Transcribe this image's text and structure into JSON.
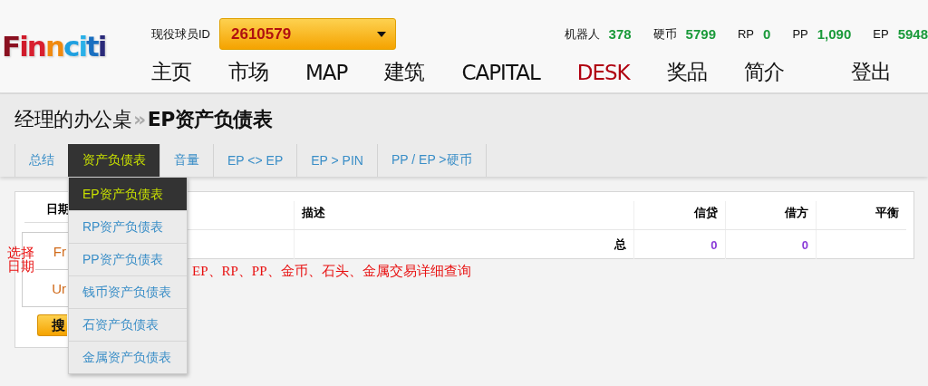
{
  "header": {
    "logo": "Finnciti",
    "player_id_label": "现役球员ID",
    "player_id": "2610579",
    "stats": [
      {
        "label": "机器人",
        "value": "378"
      },
      {
        "label": "硬币",
        "value": "5799"
      },
      {
        "label": "RP",
        "value": "0"
      },
      {
        "label": "PP",
        "value": "1,090"
      },
      {
        "label": "EP",
        "value": "5948"
      }
    ],
    "nav": [
      {
        "label": "主页",
        "selected": false
      },
      {
        "label": "市场",
        "selected": false
      },
      {
        "label": "MAP",
        "selected": false
      },
      {
        "label": "建筑",
        "selected": false
      },
      {
        "label": "CAPITAL",
        "selected": false
      },
      {
        "label": "DESK",
        "selected": true
      },
      {
        "label": "奖品",
        "selected": false
      },
      {
        "label": "简介",
        "selected": false
      }
    ],
    "logout": "登出"
  },
  "page_title": {
    "parent": "经理的办公桌",
    "separator": "»",
    "current": "EP资产负债表"
  },
  "tabs": [
    {
      "label": "总结",
      "selected": false
    },
    {
      "label": "资产负债表",
      "selected": true
    },
    {
      "label": "音量",
      "selected": false
    },
    {
      "label": "EP <> EP",
      "selected": false
    },
    {
      "label": "EP > PIN",
      "selected": false
    },
    {
      "label": "PP / EP >硬币",
      "selected": false
    }
  ],
  "tab_menu": [
    {
      "label": "EP资产负债表",
      "selected": true
    },
    {
      "label": "RP资产负债表",
      "selected": false
    },
    {
      "label": "PP资产负债表",
      "selected": false
    },
    {
      "label": "钱币资产负债表",
      "selected": false
    },
    {
      "label": "石资产负债表",
      "selected": false
    },
    {
      "label": "金属资产负债表",
      "selected": false
    }
  ],
  "filter": {
    "header": "日期",
    "fields": [
      {
        "value": "Fr"
      },
      {
        "value": "Ur"
      }
    ],
    "search_button": "搜"
  },
  "table": {
    "columns": [
      {
        "label": "描述"
      },
      {
        "label": "信贷"
      },
      {
        "label": "借方"
      },
      {
        "label": "平衡"
      }
    ],
    "rows": [
      {
        "label": "总",
        "credit": "0",
        "debit": "0"
      }
    ]
  },
  "annotations": [
    {
      "text": "选择日期"
    },
    {
      "text": "EP、RP、PP、金币、石头、金属交易详细查询"
    }
  ]
}
